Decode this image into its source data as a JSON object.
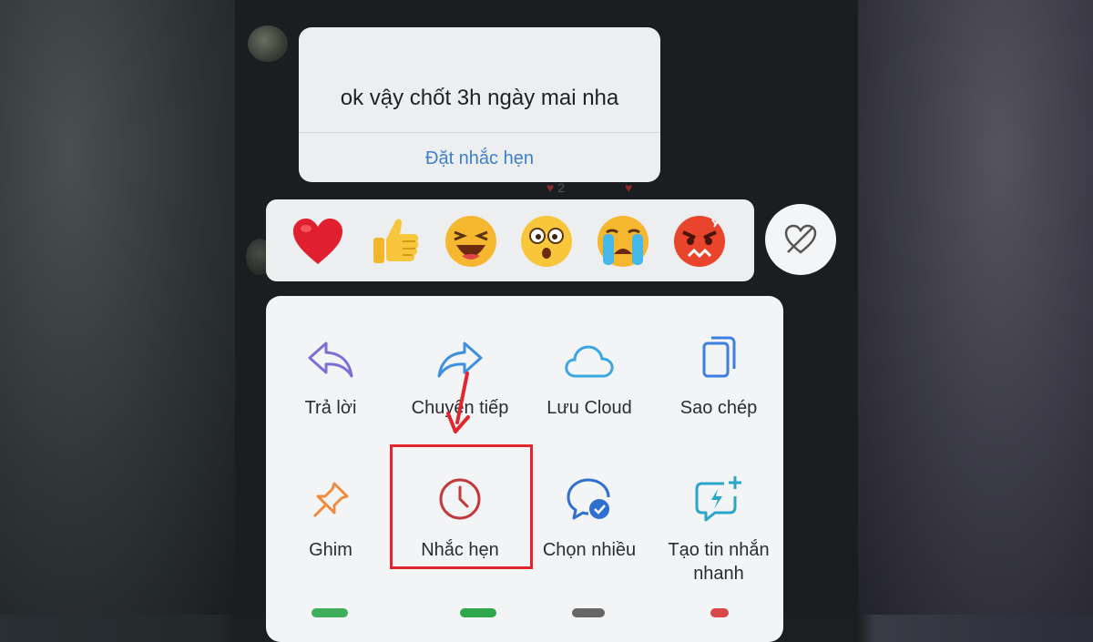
{
  "message": {
    "text": "ok vậy chốt 3h ngày mai nha",
    "action_link": "Đặt nhắc hẹn",
    "reaction_count": "2"
  },
  "reactions": [
    {
      "name": "heart",
      "glyph": "❤️"
    },
    {
      "name": "thumbs-up",
      "glyph": "👍"
    },
    {
      "name": "laughing",
      "glyph": "😆"
    },
    {
      "name": "surprised",
      "glyph": "😲"
    },
    {
      "name": "crying",
      "glyph": "😭"
    },
    {
      "name": "angry",
      "glyph": "😡"
    }
  ],
  "menu": {
    "items": [
      {
        "name": "reply",
        "label": "Trả lời",
        "icon": "reply-icon",
        "color": "#7b6fd6"
      },
      {
        "name": "forward",
        "label": "Chuyển tiếp",
        "icon": "forward-icon",
        "color": "#3d8fe0"
      },
      {
        "name": "save-cloud",
        "label": "Lưu Cloud",
        "icon": "cloud-icon",
        "color": "#3aa7e0"
      },
      {
        "name": "copy",
        "label": "Sao chép",
        "icon": "copy-icon",
        "color": "#3d7fe0"
      },
      {
        "name": "pin",
        "label": "Ghim",
        "icon": "pin-icon",
        "color": "#f08a3c"
      },
      {
        "name": "reminder",
        "label": "Nhắc hẹn",
        "icon": "clock-icon",
        "color": "#c0393b"
      },
      {
        "name": "multi-select",
        "label": "Chọn nhiều",
        "icon": "chat-check-icon",
        "color": "#2e6fd0"
      },
      {
        "name": "quick-message",
        "label": "Tạo tin nhắn nhanh",
        "icon": "quick-message-icon",
        "color": "#2aa6c8"
      }
    ]
  },
  "colors": {
    "highlight": "#e2262e",
    "link": "#3f7fc8"
  }
}
